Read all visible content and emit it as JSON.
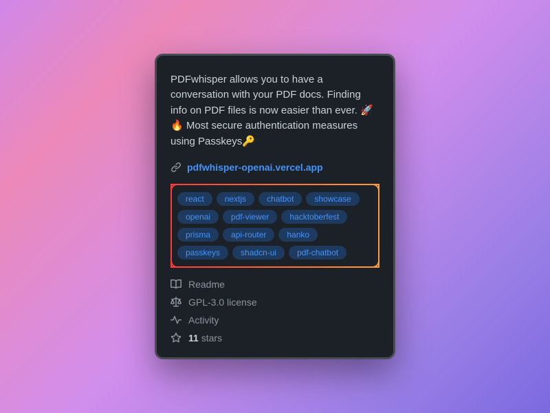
{
  "description": "PDFwhisper allows you to have a conversation with your PDF docs. Finding info on PDF files is now easier than ever. 🚀🔥 Most secure authentication measures using Passkeys🔑",
  "link": {
    "url": "pdfwhisper-openai.vercel.app"
  },
  "topics": [
    "react",
    "nextjs",
    "chatbot",
    "showcase",
    "openai",
    "pdf-viewer",
    "hacktoberfest",
    "prisma",
    "api-router",
    "hanko",
    "passkeys",
    "shadcn-ui",
    "pdf-chatbot"
  ],
  "meta": {
    "readme": "Readme",
    "license": "GPL-3.0 license",
    "activity": "Activity",
    "stars_count": "11",
    "stars_label": "stars"
  }
}
